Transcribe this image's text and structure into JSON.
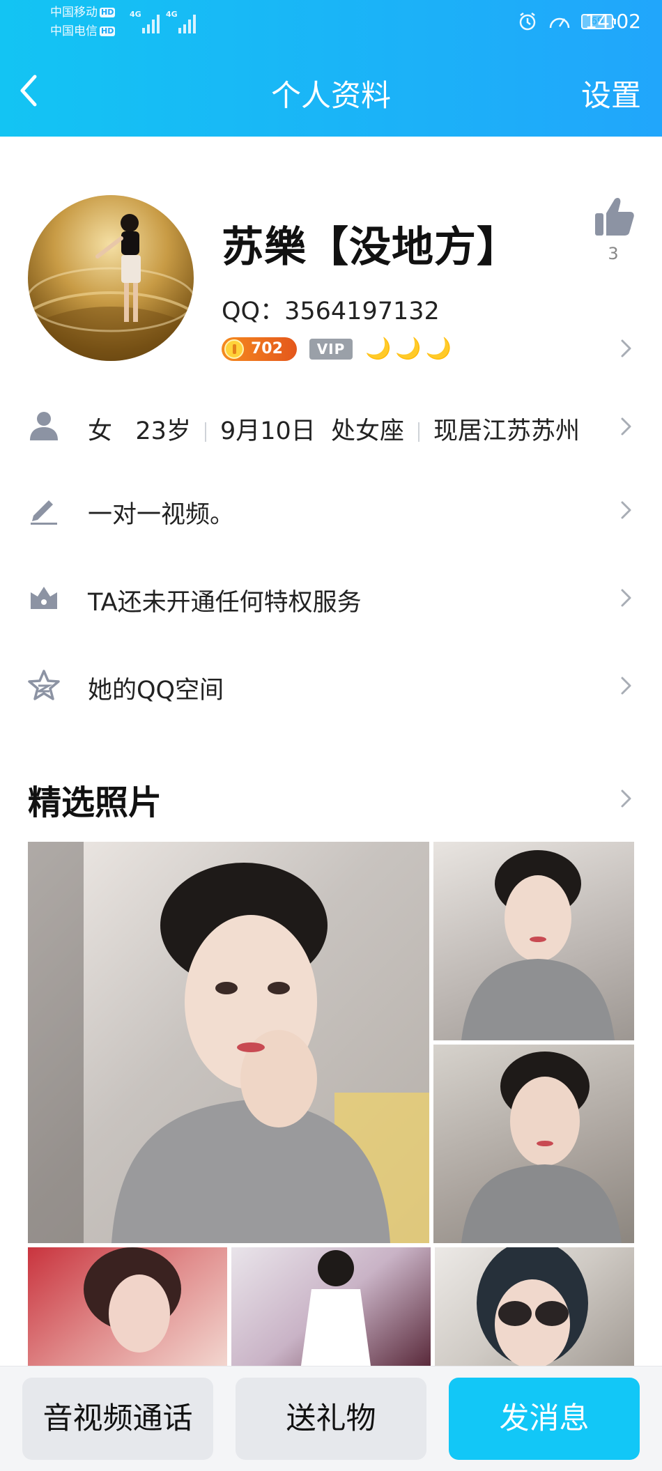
{
  "status_bar": {
    "carrier_1": "中国移动",
    "carrier_2": "中国电信",
    "hd": "HD",
    "network_1": "4G",
    "network_2": "4G",
    "battery": "69",
    "time": "14:02"
  },
  "title_bar": {
    "title": "个人资料",
    "settings_label": "设置",
    "back_icon": "chevron-left-icon"
  },
  "profile": {
    "nickname": "苏樂【没地方】",
    "qq_label": "QQ：",
    "qq_number": "3564197132",
    "coin_level": "702",
    "vip_label": "VIP",
    "moons": [
      "🌙",
      "🌙",
      "🌙"
    ],
    "like_count": "3"
  },
  "info_rows": {
    "basic": {
      "icon": "person-icon",
      "gender": "女",
      "age": "23岁",
      "birthday": "9月10日",
      "zodiac": "处女座",
      "location": "现居江苏苏州"
    },
    "signature": {
      "icon": "pencil-icon",
      "text": "一对一视频。"
    },
    "privilege": {
      "icon": "crown-icon",
      "text": "TA还未开通任何特权服务"
    },
    "qzone": {
      "icon": "qzone-star-icon",
      "text": "她的QQ空间"
    }
  },
  "photos": {
    "section_title": "精选照片",
    "count_visible": 6
  },
  "bottom_bar": {
    "call_label": "音视频通话",
    "gift_label": "送礼物",
    "message_label": "发消息"
  },
  "colors": {
    "header_start": "#13c4f3",
    "header_end": "#21a6fb",
    "primary_button": "#12c7f7",
    "icon_gray": "#8c93a3"
  }
}
